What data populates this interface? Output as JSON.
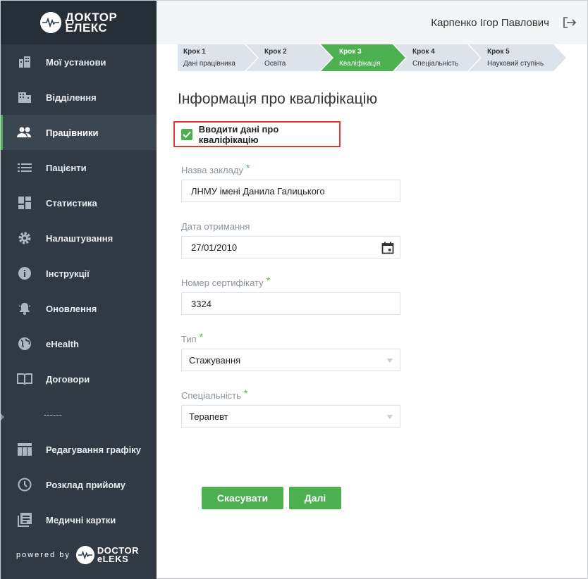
{
  "brand": {
    "logo_line1": "ДОКТОР",
    "logo_line2": "ЕЛЕКС",
    "powered_by": "powered by",
    "footer_logo_line1": "DOCTOR",
    "footer_logo_line2": "eLEKS"
  },
  "header": {
    "user_name": "Карпенко Ігор Павлович"
  },
  "sidebar": {
    "items": [
      {
        "label": "Мої установи",
        "icon": "buildings-icon"
      },
      {
        "label": "Відділення",
        "icon": "building-icon"
      },
      {
        "label": "Працівники",
        "icon": "people-icon",
        "active": true
      },
      {
        "label": "Пацієнти",
        "icon": "list-icon"
      },
      {
        "label": "Статистика",
        "icon": "dashboard-icon"
      },
      {
        "label": "Налаштування",
        "icon": "gear-icon"
      },
      {
        "label": "Інструкції",
        "icon": "info-icon"
      },
      {
        "label": "Оновлення",
        "icon": "bell-icon"
      },
      {
        "label": "eHealth",
        "icon": "globe-icon"
      },
      {
        "label": "Договори",
        "icon": "book-icon"
      },
      {
        "label": "------",
        "separator": true
      },
      {
        "label": "Редагування графіку",
        "icon": "table-icon"
      },
      {
        "label": "Розклад прийому",
        "icon": "clock-icon"
      },
      {
        "label": "Медичні картки",
        "icon": "records-icon"
      }
    ]
  },
  "stepper": {
    "steps": [
      {
        "num": "Крок 1",
        "label": "Дані працівника"
      },
      {
        "num": "Крок 2",
        "label": "Освіта"
      },
      {
        "num": "Крок 3",
        "label": "Кваліфікація",
        "active": true
      },
      {
        "num": "Крок 4",
        "label": "Спеціальність"
      },
      {
        "num": "Крок 5",
        "label": "Науковий ступінь"
      }
    ]
  },
  "form": {
    "title": "Інформація про кваліфікацію",
    "checkbox_label": "Вводити дані про кваліфікацію",
    "checkbox_checked": true,
    "institution_label": "Назва закладу",
    "institution_value": "ЛНМУ імені Данила Галицького",
    "date_label": "Дата отримання",
    "date_value": "27/01/2010",
    "certificate_label": "Номер сертифікату",
    "certificate_value": "3324",
    "type_label": "Тип",
    "type_value": "Стажування",
    "specialty_label": "Спеціальність",
    "specialty_value": "Терапевт",
    "required_mark": "*"
  },
  "actions": {
    "cancel_label": "Скасувати",
    "next_label": "Далі"
  },
  "colors": {
    "accent": "#4caf50",
    "sidebar_bg": "#2f3a45",
    "highlight_border": "#e53935"
  }
}
